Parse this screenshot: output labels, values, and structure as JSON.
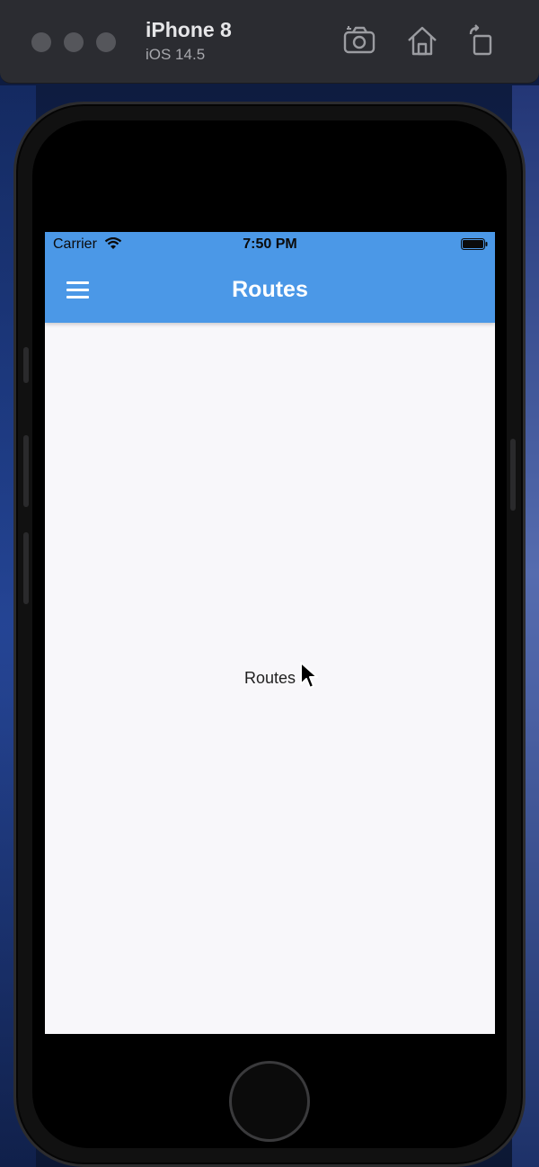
{
  "simulator": {
    "device_name": "iPhone 8",
    "os_version": "iOS 14.5",
    "toolbar_icons": [
      "screenshot-icon",
      "home-icon",
      "rotate-icon"
    ]
  },
  "status_bar": {
    "carrier": "Carrier",
    "time": "7:50 PM"
  },
  "app_bar": {
    "title": "Routes",
    "menu_icon": "hamburger-menu-icon",
    "color": "#4b98e7"
  },
  "body": {
    "center_text": "Routes",
    "background": "#f8f7fa"
  }
}
